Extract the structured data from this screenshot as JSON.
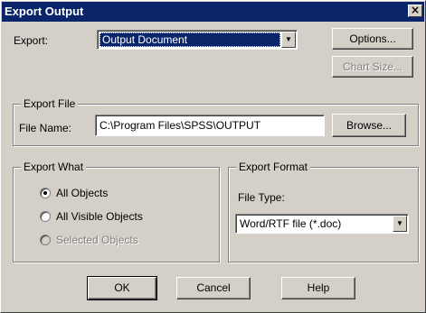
{
  "dialog": {
    "title": "Export Output",
    "close_glyph": "×"
  },
  "export": {
    "label": "Export:",
    "selected": "Output Document",
    "arrow_glyph": "▼"
  },
  "buttons": {
    "options": "Options...",
    "chart_size": "Chart Size...",
    "browse": "Browse...",
    "ok": "OK",
    "cancel": "Cancel",
    "help": "Help"
  },
  "export_file": {
    "group_title": "Export File",
    "file_name_label": "File Name:",
    "file_name_value": "C:\\Program Files\\SPSS\\OUTPUT"
  },
  "export_what": {
    "group_title": "Export What",
    "options": [
      {
        "label": "All Objects",
        "checked": true,
        "enabled": true
      },
      {
        "label": "All Visible Objects",
        "checked": false,
        "enabled": true
      },
      {
        "label": "Selected Objects",
        "checked": false,
        "enabled": false
      }
    ]
  },
  "export_format": {
    "group_title": "Export Format",
    "file_type_label": "File Type:",
    "file_type_value": "Word/RTF file (*.doc)",
    "arrow_glyph": "▼"
  },
  "colors": {
    "face": "#d4d0c8",
    "title_bar": "#0a246a",
    "selection": "#0a246a"
  }
}
